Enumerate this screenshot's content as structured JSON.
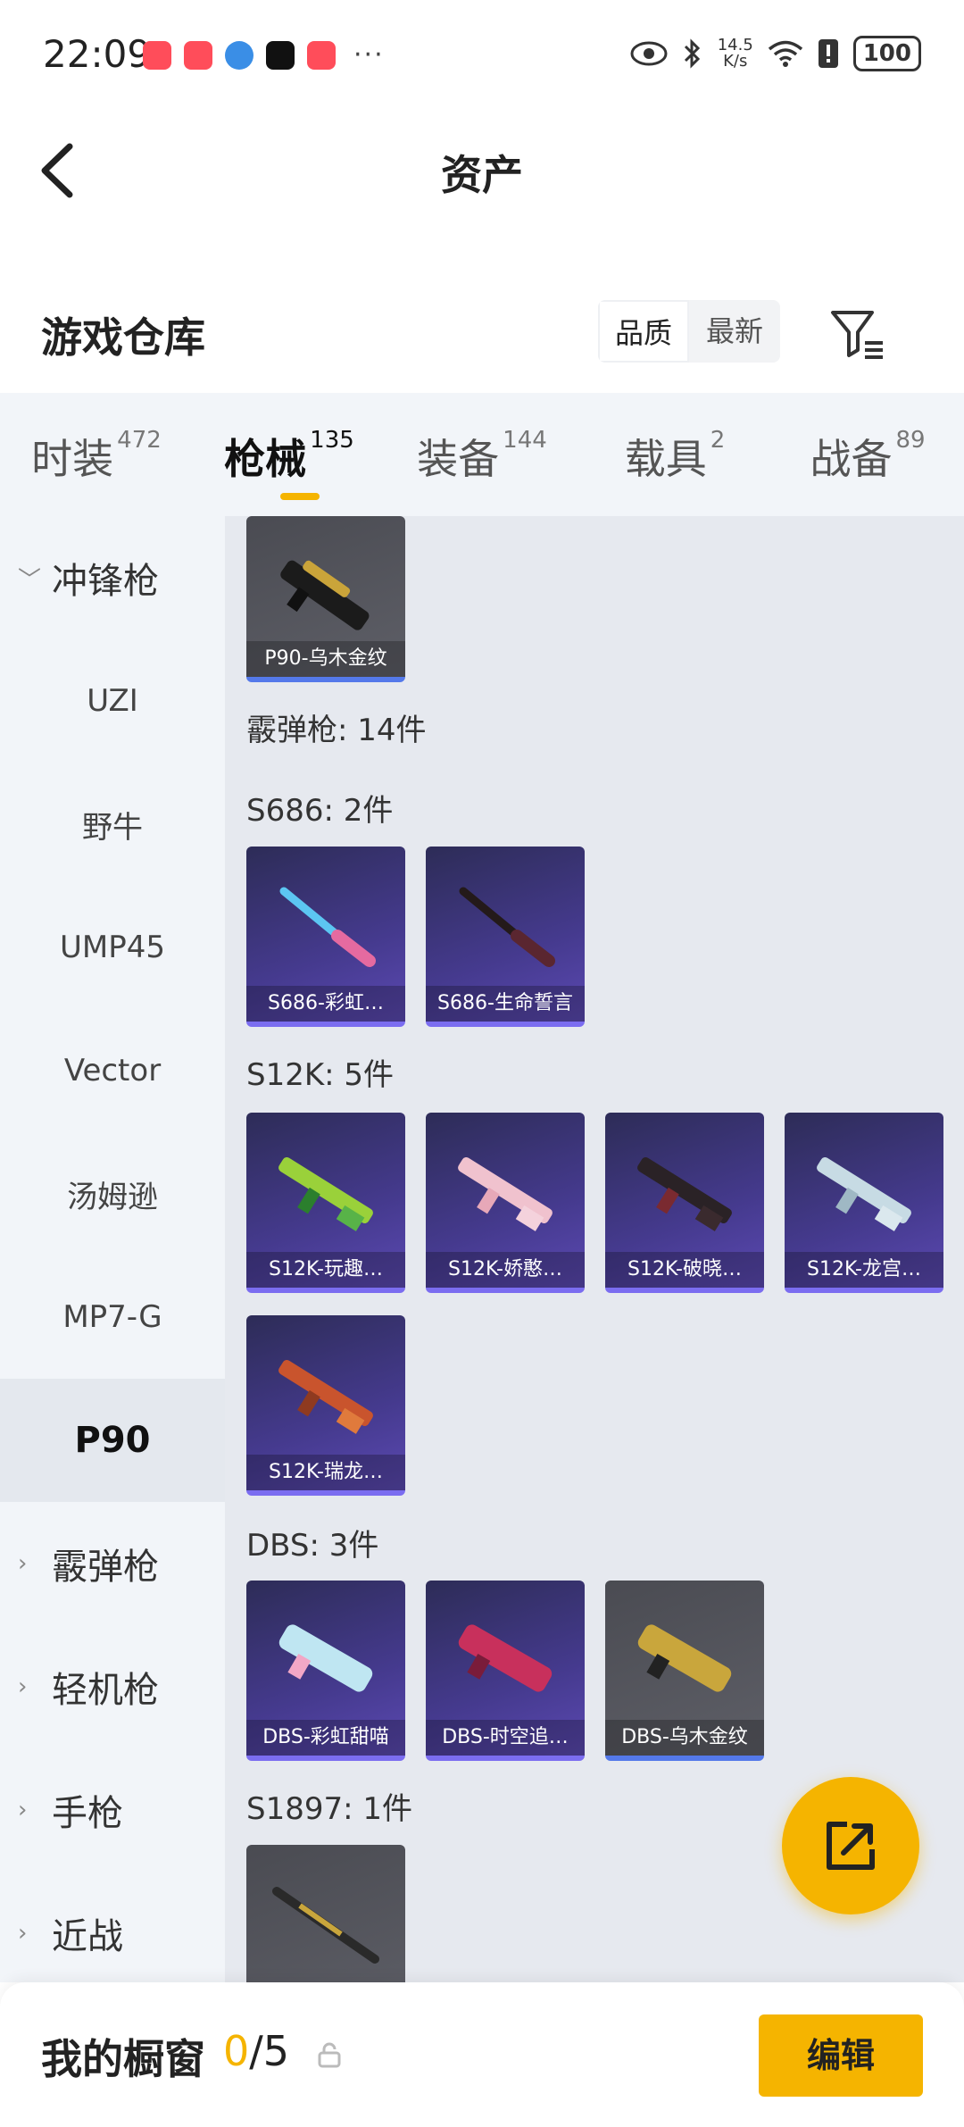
{
  "status_bar": {
    "time": "22:09",
    "more": "···",
    "net_speed_value": "14.5",
    "net_speed_unit": "K/s",
    "battery": "100"
  },
  "header": {
    "title": "资产"
  },
  "warehouse": {
    "title": "游戏仓库",
    "sort_options": [
      "品质",
      "最新"
    ],
    "selected_sort": "品质"
  },
  "tabs": [
    {
      "label": "时装",
      "count": "472"
    },
    {
      "label": "枪械",
      "count": "135",
      "active": true
    },
    {
      "label": "装备",
      "count": "144"
    },
    {
      "label": "载具",
      "count": "2"
    },
    {
      "label": "战备",
      "count": "89"
    }
  ],
  "sidebar": {
    "items": [
      {
        "label": "冲锋枪",
        "type": "group",
        "expanded": true
      },
      {
        "label": "UZI"
      },
      {
        "label": "野牛"
      },
      {
        "label": "UMP45"
      },
      {
        "label": "Vector"
      },
      {
        "label": "汤姆逊"
      },
      {
        "label": "MP7-G"
      },
      {
        "label": "P90",
        "active": true
      },
      {
        "label": "霰弹枪",
        "type": "group"
      },
      {
        "label": "轻机枪",
        "type": "group"
      },
      {
        "label": "手枪",
        "type": "group"
      },
      {
        "label": "近战",
        "type": "group"
      }
    ]
  },
  "content": {
    "top_card": {
      "name": "P90-乌木金纹",
      "style": "gray"
    },
    "category_title": "霰弹枪: 14件",
    "sections": [
      {
        "title": "S686: 2件",
        "items": [
          "S686-彩虹…",
          "S686-生命誓言"
        ]
      },
      {
        "title": "S12K: 5件",
        "items": [
          "S12K-玩趣…",
          "S12K-娇憨…",
          "S12K-破晓…",
          "S12K-龙宫…",
          "S12K-瑞龙…"
        ]
      },
      {
        "title": "DBS: 3件",
        "items": [
          "DBS-彩虹甜喵",
          "DBS-时空追…",
          "DBS-乌木金纹"
        ]
      },
      {
        "title": "S1897: 1件",
        "items": [
          ""
        ]
      }
    ]
  },
  "bottom_bar": {
    "title": "我的橱窗",
    "current": "0",
    "total": "/5",
    "edit_label": "编辑"
  },
  "colors": {
    "accent": "#f5b400",
    "card_purple": "#453a8e",
    "card_gray": "#5e5f67"
  }
}
